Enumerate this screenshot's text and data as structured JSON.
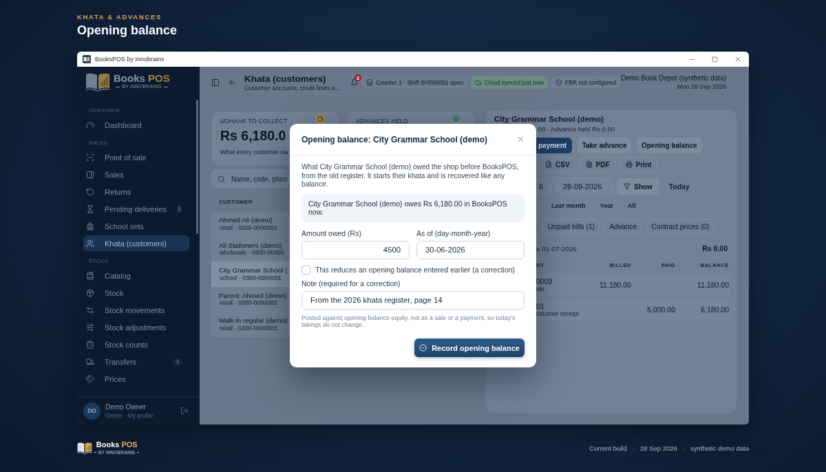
{
  "page_header": {
    "eyebrow": "KHATA & ADVANCES",
    "title": "Opening balance"
  },
  "window": {
    "title": "BooksPOS by Innobrains"
  },
  "sidebar": {
    "logo": {
      "name": "Books",
      "accent": "POS",
      "tagline": "BY INNOBRAINS"
    },
    "sections": [
      {
        "label": "OVERVIEW",
        "items": [
          {
            "label": "Dashboard",
            "selected": false
          }
        ]
      },
      {
        "label": "SALES",
        "items": [
          {
            "label": "Point of sale",
            "selected": false
          },
          {
            "label": "Sales",
            "selected": false
          },
          {
            "label": "Returns",
            "selected": false
          },
          {
            "label": "Pending deliveries",
            "selected": false,
            "badge": "1"
          },
          {
            "label": "School sets",
            "selected": false
          },
          {
            "label": "Khata (customers)",
            "selected": true
          }
        ]
      },
      {
        "label": "STOCK",
        "items": [
          {
            "label": "Catalog",
            "selected": false
          },
          {
            "label": "Stock",
            "selected": false
          },
          {
            "label": "Stock movements",
            "selected": false
          },
          {
            "label": "Stock adjustments",
            "selected": false
          },
          {
            "label": "Stock counts",
            "selected": false
          },
          {
            "label": "Transfers",
            "selected": false,
            "badge": "1"
          },
          {
            "label": "Prices",
            "selected": false
          }
        ]
      }
    ],
    "user": {
      "initials": "DO",
      "name": "Demo Owner",
      "role": "Owner · My profile"
    }
  },
  "topbar": {
    "title": "Khata (customers)",
    "subtitle": "Customer accounts, credit limits a…",
    "notifications": "3",
    "statuses": [
      {
        "kind": "counter",
        "label": "Counter 1 · Shift SH000001 open"
      },
      {
        "kind": "sync",
        "label": "Cloud synced just now"
      },
      {
        "kind": "tax",
        "label": "FBR not configured"
      }
    ],
    "shop": "Demo Book Depot (synthetic data)",
    "date": "Mon 28 Sep 2026"
  },
  "stats": [
    {
      "kind": "receivable",
      "label": "UDHAAR TO COLLECT",
      "value": "Rs 6,180.0",
      "note": "What every customer ow"
    },
    {
      "kind": "advance",
      "label": "ADVANCES HELD"
    }
  ],
  "customers": {
    "search": {
      "placeholder": "Name, code, phon"
    },
    "column": "CUSTOMER",
    "rows": [
      {
        "name": "Ahmed Ali (demo)",
        "detail": "retail · 0300-0000002",
        "selected": false
      },
      {
        "name": "Ali Stationers (demo)",
        "detail": "wholesale · 0300-00000",
        "selected": false
      },
      {
        "name": "City Grammar School (",
        "detail": "school · 0300-0000001",
        "selected": true
      },
      {
        "name": "Parent: Ahmed (demo)",
        "detail": "retail · 0300-0000005",
        "selected": false
      },
      {
        "name": "Walk-in regular (demo)",
        "detail": "retail · 0300-0000003",
        "selected": false
      }
    ]
  },
  "customer_panel": {
    "title": "City Grammar School (demo)",
    "summary": ".00 · Advance held Rs 0.00",
    "actions": [
      {
        "kind": "primary",
        "label": "payment"
      },
      {
        "kind": "secondary",
        "label": "Take advance"
      },
      {
        "kind": "secondary",
        "label": "Opening balance"
      }
    ],
    "exports": [
      {
        "kind": "csv",
        "label": "CSV"
      },
      {
        "kind": "pdf",
        "label": "PDF"
      },
      {
        "kind": "print",
        "label": "Print"
      }
    ],
    "date_from": "6",
    "date_to": "28-09-2026",
    "show": "Show",
    "today": "Today",
    "ranges": [
      "Last month",
      "Year",
      "All"
    ],
    "views": [
      {
        "label": "Unpaid bills (1)",
        "selected": false
      },
      {
        "label": "Advance",
        "selected": false
      },
      {
        "label": "Contract prices (0)",
        "selected": false
      }
    ],
    "opening": {
      "label": "e 01-07-2026",
      "amount": "Rs 0.00"
    },
    "ledger": {
      "columns": [
        "NT",
        "BILLED",
        "PAID",
        "BALANCE"
      ],
      "rows": [
        {
          "document": "0003",
          "detail": "ale",
          "billed": "11,180.00",
          "balance": "11,180.00"
        },
        {
          "document": "01",
          "detail": "ustomer receipt",
          "paid": "5,000.00",
          "balance": "6,180.00"
        }
      ]
    }
  },
  "dialog": {
    "title": "Opening balance: City Grammar School (demo)",
    "intro": "What City Grammar School (demo) owed the shop before BooksPOS, from the old register. It starts their khata and is recovered like any balance.",
    "notice": "City Grammar School (demo) owes Rs 6,180.00 in BooksPOS now.",
    "amount": {
      "label": "Amount owed (Rs)",
      "value": "4500"
    },
    "as_of": {
      "label": "As of (day-month-year)",
      "value": "30-06-2026"
    },
    "correction": {
      "label": "This reduces an opening balance entered earlier (a correction)",
      "checked": false
    },
    "note": {
      "label": "Note (required for a correction)",
      "value": "From the 2026 khata register, page 14"
    },
    "hint": "Posted against opening balance equity, not as a sale or a payment, so today's takings do not change.",
    "submit": "Record opening balance"
  },
  "footer": {
    "logo": {
      "name": "Books",
      "accent": "POS",
      "tagline": "BY INNOBRAINS"
    },
    "meta": [
      {
        "kind": "text",
        "label": "Current build"
      },
      {
        "kind": "separator",
        "label": "·"
      },
      {
        "kind": "text",
        "label": "28 Sep 2026"
      },
      {
        "kind": "separator",
        "label": "·"
      },
      {
        "kind": "text",
        "label": "synthetic demo data"
      }
    ]
  }
}
